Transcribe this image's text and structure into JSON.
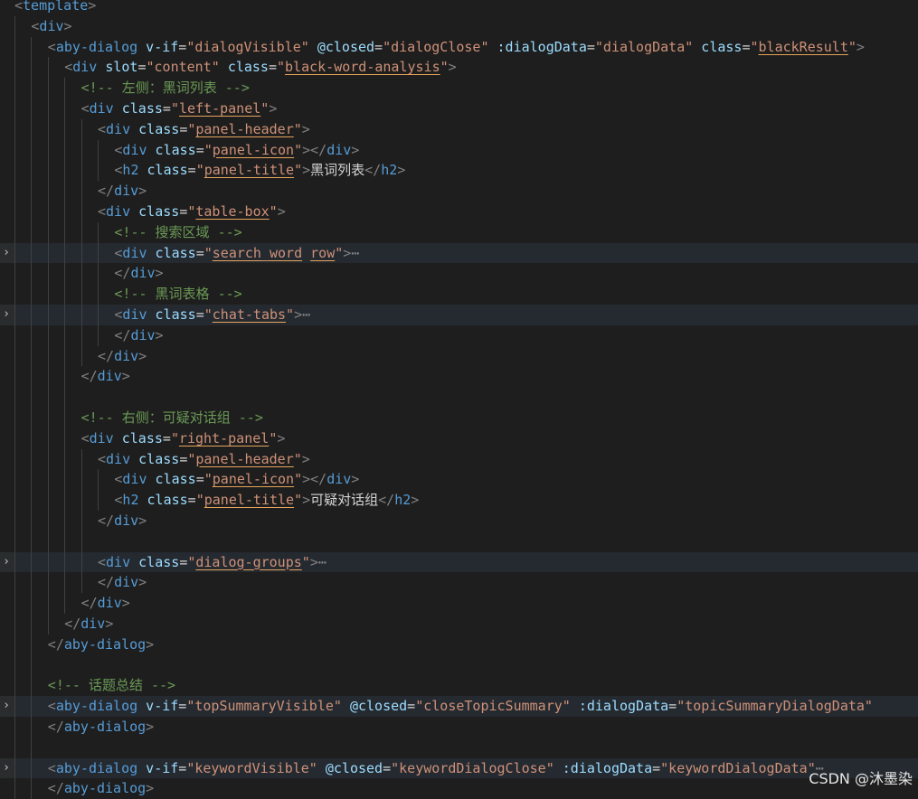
{
  "editor": {
    "lines": [
      {
        "indent": 0,
        "fold": false,
        "hl": false,
        "tokens": [
          [
            "bracket",
            "<"
          ],
          [
            "tag",
            "template"
          ],
          [
            "bracket",
            ">"
          ]
        ]
      },
      {
        "indent": 1,
        "fold": false,
        "hl": false,
        "tokens": [
          [
            "bracket",
            "<"
          ],
          [
            "tag",
            "div"
          ],
          [
            "bracket",
            ">"
          ]
        ]
      },
      {
        "indent": 2,
        "fold": false,
        "hl": false,
        "tokens": [
          [
            "bracket",
            "<"
          ],
          [
            "tag",
            "aby-dialog"
          ],
          [
            "text",
            " "
          ],
          [
            "attr",
            "v-if"
          ],
          [
            "text",
            "="
          ],
          [
            "str",
            "\"dialogVisible\""
          ],
          [
            "text",
            " "
          ],
          [
            "attr",
            "@closed"
          ],
          [
            "text",
            "="
          ],
          [
            "str",
            "\"dialogClose\""
          ],
          [
            "text",
            " "
          ],
          [
            "attr",
            ":dialogData"
          ],
          [
            "text",
            "="
          ],
          [
            "str",
            "\"dialogData\""
          ],
          [
            "text",
            " "
          ],
          [
            "attr",
            "class"
          ],
          [
            "text",
            "="
          ],
          [
            "str",
            "\""
          ],
          [
            "strul",
            "blackResult"
          ],
          [
            "str",
            "\""
          ],
          [
            "bracket",
            ">"
          ]
        ]
      },
      {
        "indent": 3,
        "fold": false,
        "hl": false,
        "tokens": [
          [
            "bracket",
            "<"
          ],
          [
            "tag",
            "div"
          ],
          [
            "text",
            " "
          ],
          [
            "attr",
            "slot"
          ],
          [
            "text",
            "="
          ],
          [
            "str",
            "\"content\""
          ],
          [
            "text",
            " "
          ],
          [
            "attr",
            "class"
          ],
          [
            "text",
            "="
          ],
          [
            "str",
            "\""
          ],
          [
            "strul",
            "black-word-analysis"
          ],
          [
            "str",
            "\""
          ],
          [
            "bracket",
            ">"
          ]
        ]
      },
      {
        "indent": 4,
        "fold": false,
        "hl": false,
        "tokens": [
          [
            "comment",
            "<!-- 左侧：黑词列表 -->"
          ]
        ]
      },
      {
        "indent": 4,
        "fold": false,
        "hl": false,
        "tokens": [
          [
            "bracket",
            "<"
          ],
          [
            "tag",
            "div"
          ],
          [
            "text",
            " "
          ],
          [
            "attr",
            "class"
          ],
          [
            "text",
            "="
          ],
          [
            "str",
            "\""
          ],
          [
            "strul",
            "left-panel"
          ],
          [
            "str",
            "\""
          ],
          [
            "bracket",
            ">"
          ]
        ]
      },
      {
        "indent": 5,
        "fold": false,
        "hl": false,
        "tokens": [
          [
            "bracket",
            "<"
          ],
          [
            "tag",
            "div"
          ],
          [
            "text",
            " "
          ],
          [
            "attr",
            "class"
          ],
          [
            "text",
            "="
          ],
          [
            "str",
            "\""
          ],
          [
            "strul",
            "panel-header"
          ],
          [
            "str",
            "\""
          ],
          [
            "bracket",
            ">"
          ]
        ]
      },
      {
        "indent": 6,
        "fold": false,
        "hl": false,
        "tokens": [
          [
            "bracket",
            "<"
          ],
          [
            "tag",
            "div"
          ],
          [
            "text",
            " "
          ],
          [
            "attr",
            "class"
          ],
          [
            "text",
            "="
          ],
          [
            "str",
            "\""
          ],
          [
            "strul",
            "panel-icon"
          ],
          [
            "str",
            "\""
          ],
          [
            "bracket",
            "></"
          ],
          [
            "tag",
            "div"
          ],
          [
            "bracket",
            ">"
          ]
        ]
      },
      {
        "indent": 6,
        "fold": false,
        "hl": false,
        "tokens": [
          [
            "bracket",
            "<"
          ],
          [
            "tag",
            "h2"
          ],
          [
            "text",
            " "
          ],
          [
            "attr",
            "class"
          ],
          [
            "text",
            "="
          ],
          [
            "str",
            "\""
          ],
          [
            "strul",
            "panel-title"
          ],
          [
            "str",
            "\""
          ],
          [
            "bracket",
            ">"
          ],
          [
            "text",
            "黑词列表"
          ],
          [
            "bracket",
            "</"
          ],
          [
            "tag",
            "h2"
          ],
          [
            "bracket",
            ">"
          ]
        ]
      },
      {
        "indent": 5,
        "fold": false,
        "hl": false,
        "tokens": [
          [
            "bracket",
            "</"
          ],
          [
            "tag",
            "div"
          ],
          [
            "bracket",
            ">"
          ]
        ]
      },
      {
        "indent": 5,
        "fold": false,
        "hl": false,
        "tokens": [
          [
            "bracket",
            "<"
          ],
          [
            "tag",
            "div"
          ],
          [
            "text",
            " "
          ],
          [
            "attr",
            "class"
          ],
          [
            "text",
            "="
          ],
          [
            "str",
            "\""
          ],
          [
            "strul",
            "table-box"
          ],
          [
            "str",
            "\""
          ],
          [
            "bracket",
            ">"
          ]
        ]
      },
      {
        "indent": 6,
        "fold": false,
        "hl": false,
        "tokens": [
          [
            "comment",
            "<!-- 搜索区域 -->"
          ]
        ]
      },
      {
        "indent": 6,
        "fold": true,
        "hl": true,
        "tokens": [
          [
            "bracket",
            "<"
          ],
          [
            "tag",
            "div"
          ],
          [
            "text",
            " "
          ],
          [
            "attr",
            "class"
          ],
          [
            "text",
            "="
          ],
          [
            "str",
            "\""
          ],
          [
            "strul",
            "search_word"
          ],
          [
            "str",
            " "
          ],
          [
            "strul",
            "row"
          ],
          [
            "str",
            "\""
          ],
          [
            "bracket",
            ">"
          ],
          [
            "dim",
            "⋯"
          ]
        ]
      },
      {
        "indent": 6,
        "fold": false,
        "hl": false,
        "tokens": [
          [
            "bracket",
            "</"
          ],
          [
            "tag",
            "div"
          ],
          [
            "bracket",
            ">"
          ]
        ]
      },
      {
        "indent": 6,
        "fold": false,
        "hl": false,
        "tokens": [
          [
            "comment",
            "<!-- 黑词表格 -->"
          ]
        ]
      },
      {
        "indent": 6,
        "fold": true,
        "hl": true,
        "tokens": [
          [
            "bracket",
            "<"
          ],
          [
            "tag",
            "div"
          ],
          [
            "text",
            " "
          ],
          [
            "attr",
            "class"
          ],
          [
            "text",
            "="
          ],
          [
            "str",
            "\""
          ],
          [
            "strul",
            "chat-tabs"
          ],
          [
            "str",
            "\""
          ],
          [
            "bracket",
            ">"
          ],
          [
            "dim",
            "⋯"
          ]
        ]
      },
      {
        "indent": 6,
        "fold": false,
        "hl": false,
        "tokens": [
          [
            "bracket",
            "</"
          ],
          [
            "tag",
            "div"
          ],
          [
            "bracket",
            ">"
          ]
        ]
      },
      {
        "indent": 5,
        "fold": false,
        "hl": false,
        "tokens": [
          [
            "bracket",
            "</"
          ],
          [
            "tag",
            "div"
          ],
          [
            "bracket",
            ">"
          ]
        ]
      },
      {
        "indent": 4,
        "fold": false,
        "hl": false,
        "tokens": [
          [
            "bracket",
            "</"
          ],
          [
            "tag",
            "div"
          ],
          [
            "bracket",
            ">"
          ]
        ]
      },
      {
        "indent": 4,
        "fold": false,
        "hl": false,
        "tokens": []
      },
      {
        "indent": 4,
        "fold": false,
        "hl": false,
        "tokens": [
          [
            "comment",
            "<!-- 右侧：可疑对话组 -->"
          ]
        ]
      },
      {
        "indent": 4,
        "fold": false,
        "hl": false,
        "tokens": [
          [
            "bracket",
            "<"
          ],
          [
            "tag",
            "div"
          ],
          [
            "text",
            " "
          ],
          [
            "attr",
            "class"
          ],
          [
            "text",
            "="
          ],
          [
            "str",
            "\""
          ],
          [
            "strul",
            "right-panel"
          ],
          [
            "str",
            "\""
          ],
          [
            "bracket",
            ">"
          ]
        ]
      },
      {
        "indent": 5,
        "fold": false,
        "hl": false,
        "tokens": [
          [
            "bracket",
            "<"
          ],
          [
            "tag",
            "div"
          ],
          [
            "text",
            " "
          ],
          [
            "attr",
            "class"
          ],
          [
            "text",
            "="
          ],
          [
            "str",
            "\""
          ],
          [
            "strul",
            "panel-header"
          ],
          [
            "str",
            "\""
          ],
          [
            "bracket",
            ">"
          ]
        ]
      },
      {
        "indent": 6,
        "fold": false,
        "hl": false,
        "tokens": [
          [
            "bracket",
            "<"
          ],
          [
            "tag",
            "div"
          ],
          [
            "text",
            " "
          ],
          [
            "attr",
            "class"
          ],
          [
            "text",
            "="
          ],
          [
            "str",
            "\""
          ],
          [
            "strul",
            "panel-icon"
          ],
          [
            "str",
            "\""
          ],
          [
            "bracket",
            "></"
          ],
          [
            "tag",
            "div"
          ],
          [
            "bracket",
            ">"
          ]
        ]
      },
      {
        "indent": 6,
        "fold": false,
        "hl": false,
        "tokens": [
          [
            "bracket",
            "<"
          ],
          [
            "tag",
            "h2"
          ],
          [
            "text",
            " "
          ],
          [
            "attr",
            "class"
          ],
          [
            "text",
            "="
          ],
          [
            "str",
            "\""
          ],
          [
            "strul",
            "panel-title"
          ],
          [
            "str",
            "\""
          ],
          [
            "bracket",
            ">"
          ],
          [
            "text",
            "可疑对话组"
          ],
          [
            "bracket",
            "</"
          ],
          [
            "tag",
            "h2"
          ],
          [
            "bracket",
            ">"
          ]
        ]
      },
      {
        "indent": 5,
        "fold": false,
        "hl": false,
        "tokens": [
          [
            "bracket",
            "</"
          ],
          [
            "tag",
            "div"
          ],
          [
            "bracket",
            ">"
          ]
        ]
      },
      {
        "indent": 5,
        "fold": false,
        "hl": false,
        "tokens": []
      },
      {
        "indent": 5,
        "fold": true,
        "hl": true,
        "tokens": [
          [
            "bracket",
            "<"
          ],
          [
            "tag",
            "div"
          ],
          [
            "text",
            " "
          ],
          [
            "attr",
            "class"
          ],
          [
            "text",
            "="
          ],
          [
            "str",
            "\""
          ],
          [
            "strul",
            "dialog-groups"
          ],
          [
            "str",
            "\""
          ],
          [
            "bracket",
            ">"
          ],
          [
            "dim",
            "⋯"
          ]
        ]
      },
      {
        "indent": 5,
        "fold": false,
        "hl": false,
        "tokens": [
          [
            "bracket",
            "</"
          ],
          [
            "tag",
            "div"
          ],
          [
            "bracket",
            ">"
          ]
        ]
      },
      {
        "indent": 4,
        "fold": false,
        "hl": false,
        "tokens": [
          [
            "bracket",
            "</"
          ],
          [
            "tag",
            "div"
          ],
          [
            "bracket",
            ">"
          ]
        ]
      },
      {
        "indent": 3,
        "fold": false,
        "hl": false,
        "tokens": [
          [
            "bracket",
            "</"
          ],
          [
            "tag",
            "div"
          ],
          [
            "bracket",
            ">"
          ]
        ]
      },
      {
        "indent": 2,
        "fold": false,
        "hl": false,
        "tokens": [
          [
            "bracket",
            "</"
          ],
          [
            "tag",
            "aby-dialog"
          ],
          [
            "bracket",
            ">"
          ]
        ]
      },
      {
        "indent": 2,
        "fold": false,
        "hl": false,
        "tokens": []
      },
      {
        "indent": 2,
        "fold": false,
        "hl": false,
        "tokens": [
          [
            "comment",
            "<!-- 话题总结 -->"
          ]
        ]
      },
      {
        "indent": 2,
        "fold": true,
        "hl": true,
        "tokens": [
          [
            "bracket",
            "<"
          ],
          [
            "tag",
            "aby-dialog"
          ],
          [
            "text",
            " "
          ],
          [
            "attr",
            "v-if"
          ],
          [
            "text",
            "="
          ],
          [
            "str",
            "\"topSummaryVisible\""
          ],
          [
            "text",
            " "
          ],
          [
            "attr",
            "@closed"
          ],
          [
            "text",
            "="
          ],
          [
            "str",
            "\"closeTopicSummary\""
          ],
          [
            "text",
            " "
          ],
          [
            "attr",
            ":dialogData"
          ],
          [
            "text",
            "="
          ],
          [
            "str",
            "\"topicSummaryDialogData\""
          ]
        ]
      },
      {
        "indent": 2,
        "fold": false,
        "hl": false,
        "tokens": [
          [
            "bracket",
            "</"
          ],
          [
            "tag",
            "aby-dialog"
          ],
          [
            "bracket",
            ">"
          ]
        ]
      },
      {
        "indent": 2,
        "fold": false,
        "hl": false,
        "tokens": []
      },
      {
        "indent": 2,
        "fold": true,
        "hl": true,
        "tokens": [
          [
            "bracket",
            "<"
          ],
          [
            "tag",
            "aby-dialog"
          ],
          [
            "text",
            " "
          ],
          [
            "attr",
            "v-if"
          ],
          [
            "text",
            "="
          ],
          [
            "str",
            "\"keywordVisible\""
          ],
          [
            "text",
            " "
          ],
          [
            "attr",
            "@closed"
          ],
          [
            "text",
            "="
          ],
          [
            "str",
            "\"keywordDialogClose\""
          ],
          [
            "text",
            " "
          ],
          [
            "attr",
            ":dialogData"
          ],
          [
            "text",
            "="
          ],
          [
            "str",
            "\"keywordDialogData\""
          ],
          [
            "dim",
            "⋯"
          ]
        ]
      },
      {
        "indent": 2,
        "fold": false,
        "hl": false,
        "tokens": [
          [
            "bracket",
            "</"
          ],
          [
            "tag",
            "aby-dialog"
          ],
          [
            "bracket",
            ">"
          ]
        ]
      }
    ]
  },
  "watermark": "CSDN @沐墨染",
  "icons": {
    "fold": "chevron-right-icon"
  }
}
